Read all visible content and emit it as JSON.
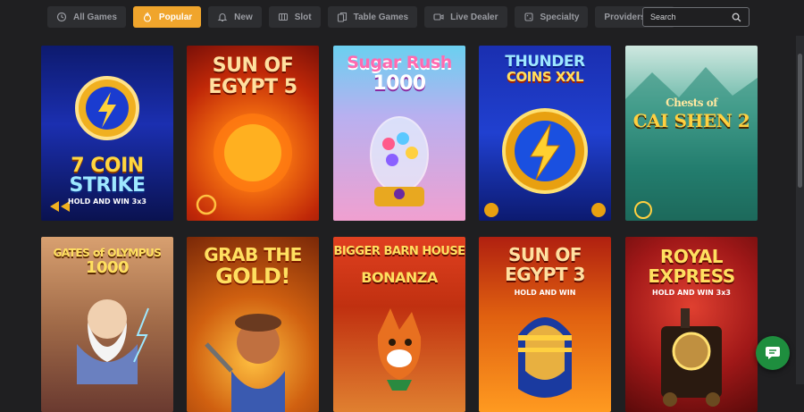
{
  "filters": [
    {
      "label": "All Games",
      "icon": "clock-icon"
    },
    {
      "label": "Popular",
      "icon": "flame-icon",
      "active": true
    },
    {
      "label": "New",
      "icon": "bell-icon"
    },
    {
      "label": "Slot",
      "icon": "slot-machine-icon"
    },
    {
      "label": "Table Games",
      "icon": "cards-icon"
    },
    {
      "label": "Live Dealer",
      "icon": "video-icon"
    },
    {
      "label": "Specialty",
      "icon": "dice-icon"
    }
  ],
  "providers": {
    "label": "Providers",
    "icon": "chevron-down-icon"
  },
  "search": {
    "placeholder": "Search",
    "icon": "search-icon"
  },
  "games": [
    {
      "title_line1": "7 COIN",
      "title_line2": "STRIKE",
      "subtitle": "HOLD AND WIN 3x3"
    },
    {
      "title_line1": "SUN OF",
      "title_line2": "EGYPT 5",
      "subtitle": ""
    },
    {
      "title_line1": "Sugar Rush",
      "title_line2": "1000",
      "subtitle": ""
    },
    {
      "title_line1": "THUNDER",
      "title_line2": "COINS XXL",
      "subtitle": ""
    },
    {
      "title_line1": "Chests of",
      "title_line2": "CAI SHEN 2",
      "subtitle": ""
    },
    {
      "title_line1": "GATES of OLYMPUS",
      "title_line2": "1000",
      "subtitle": ""
    },
    {
      "title_line1": "GRAB THE",
      "title_line2": "GOLD!",
      "subtitle": ""
    },
    {
      "title_line1": "BIGGER BARN HOUSE",
      "title_line2": "BONANZA",
      "subtitle": ""
    },
    {
      "title_line1": "SUN OF",
      "title_line2": "EGYPT 3",
      "subtitle": "HOLD AND WIN"
    },
    {
      "title_line1": "ROYAL",
      "title_line2": "EXPRESS",
      "subtitle": "HOLD AND WIN 3x3"
    }
  ],
  "colors": {
    "accent": "#f0a52c",
    "background": "#1f1f21",
    "chip": "#2d2e31",
    "chat": "#1e8e3e"
  },
  "chat": {
    "icon": "chat-bubble-icon"
  }
}
